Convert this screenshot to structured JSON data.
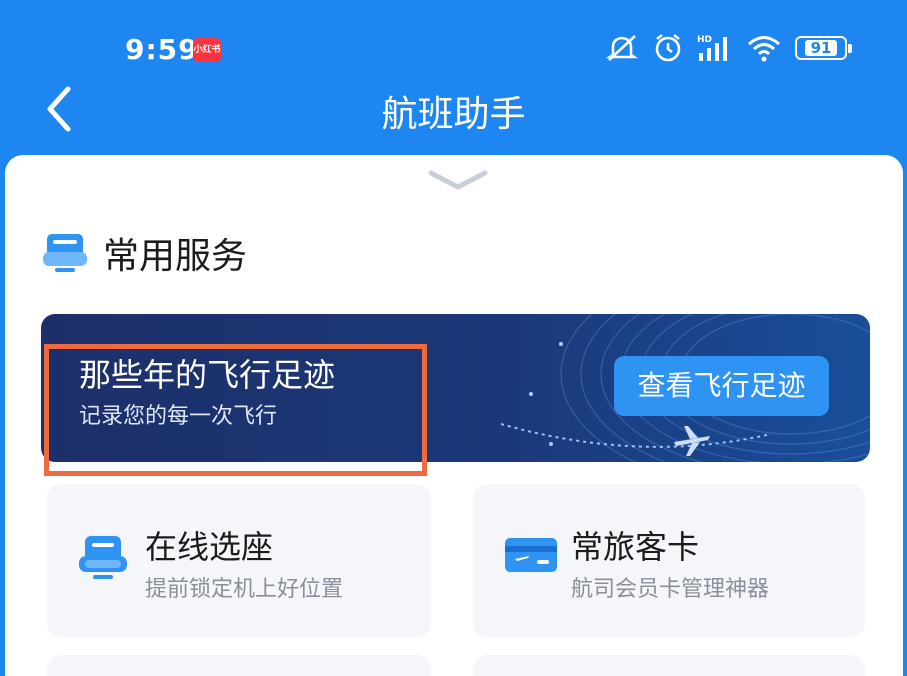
{
  "status_bar": {
    "time": "9:59",
    "app_badge": "小红书",
    "battery": "91"
  },
  "nav": {
    "title": "航班助手"
  },
  "section": {
    "title": "常用服务"
  },
  "banner": {
    "title": "那些年的飞行足迹",
    "subtitle": "记录您的每一次飞行",
    "button": "查看飞行足迹"
  },
  "cards": [
    {
      "title": "在线选座",
      "subtitle": "提前锁定机上好位置"
    },
    {
      "title": "常旅客卡",
      "subtitle": "航司会员卡管理神器"
    }
  ],
  "colors": {
    "primary_blue": "#1e86f0",
    "banner_dark": "#1d2f6a",
    "highlight": "#ef6a3d"
  }
}
